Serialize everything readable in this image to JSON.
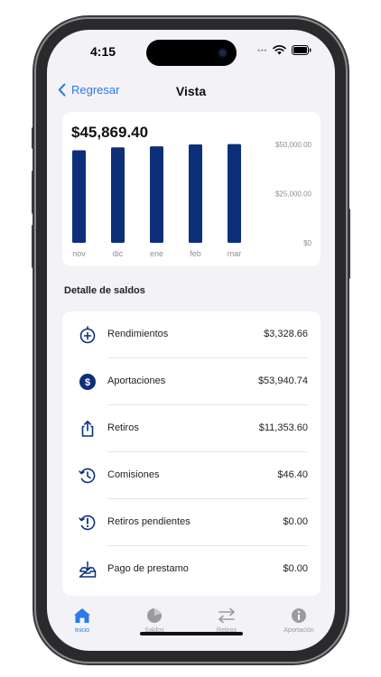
{
  "status_bar": {
    "time": "4:15",
    "dots": "•••"
  },
  "nav": {
    "back_label": "Regresar",
    "title": "Vista"
  },
  "summary": {
    "balance": "$45,869.40"
  },
  "chart_data": {
    "type": "bar",
    "categories": [
      "nov",
      "dic",
      "ene",
      "feb",
      "mar"
    ],
    "values": [
      47000,
      48500,
      49000,
      50000,
      50200
    ],
    "y_ticks": [
      {
        "value": 50000,
        "label": "$50,000.00"
      },
      {
        "value": 25000,
        "label": "$25,000.00"
      },
      {
        "value": 0,
        "label": "$0"
      }
    ],
    "ylim": [
      0,
      50000
    ],
    "color": "#0d2f7a",
    "grid": false
  },
  "details": {
    "title": "Detalle de saldos",
    "rows": [
      {
        "label": "Rendimientos",
        "value": "$3,328.66",
        "icon": "timer-plus-icon"
      },
      {
        "label": "Aportaciones",
        "value": "$53,940.74",
        "icon": "dollar-circle-icon"
      },
      {
        "label": "Retiros",
        "value": "$11,353.60",
        "icon": "share-up-icon"
      },
      {
        "label": "Comisiones",
        "value": "$46.40",
        "icon": "clock-cycle-icon"
      },
      {
        "label": "Retiros pendientes",
        "value": "$0.00",
        "icon": "alert-cycle-icon"
      },
      {
        "label": "Pago de prestamo",
        "value": "$0.00",
        "icon": "tray-download-icon"
      }
    ]
  },
  "tabs": [
    {
      "label": "Inicio",
      "icon": "house-icon",
      "active": true
    },
    {
      "label": "Saldos",
      "icon": "pie-chart-icon",
      "active": false
    },
    {
      "label": "Retiros",
      "icon": "arrows-swap-icon",
      "active": false
    },
    {
      "label": "Aportación",
      "icon": "info-icon",
      "active": false
    }
  ],
  "colors": {
    "accent": "#2a7be4",
    "bar": "#0d2f7a",
    "icon": "#0d2f7a",
    "background": "#f2f2f7"
  }
}
